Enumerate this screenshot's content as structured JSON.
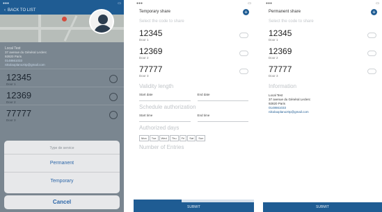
{
  "phone1": {
    "status_carrier": "",
    "nav_back_label": "BACK TO LIST",
    "contact": {
      "name": "Local Test",
      "address": "37 avenue du Général Leclerc",
      "city": "92820 Paris",
      "phone": "0148661033",
      "email": "nikolaoplanoz0p@gmail.com"
    },
    "codes": [
      {
        "number": "12345",
        "door": "Door 1"
      },
      {
        "number": "12369",
        "door": "Door 2"
      },
      {
        "number": "77777",
        "door": "Door 3"
      }
    ],
    "sheet": {
      "title": "Type de service",
      "options": [
        "Permanent",
        "Temporary"
      ],
      "cancel": "Cancel"
    }
  },
  "phone2": {
    "title": "Temporary share",
    "hint": "Select the code to share",
    "codes": [
      {
        "number": "12345",
        "door": "Door 1"
      },
      {
        "number": "12369",
        "door": "Door 2"
      },
      {
        "number": "77777",
        "door": "Door 3"
      }
    ],
    "validity_title": "Validity length",
    "start_date": "Start date",
    "end_date": "End date",
    "schedule_title": "Schedule authorization",
    "start_time": "Start time",
    "end_time": "End time",
    "days_title": "Authorized days",
    "days": [
      "Mon",
      "Tue",
      "Wed",
      "Thu",
      "Fri",
      "Sat",
      "Sun"
    ],
    "entries_title": "Number of Entries",
    "progress": 0.4,
    "submit": "SUBMIT"
  },
  "phone3": {
    "title": "Permanent share",
    "hint": "Select the code to share",
    "codes": [
      {
        "number": "12345",
        "door": "Door 1"
      },
      {
        "number": "12369",
        "door": "Door 2"
      },
      {
        "number": "77777",
        "door": "Door 3"
      }
    ],
    "info_title": "Information",
    "contact": {
      "name": "Local Test",
      "address": "37 avenue du Général Leclerc",
      "city": "92820 Paris",
      "phone": "0148661033",
      "email": "nikolaoplanoz0p@gmail.com"
    },
    "submit": "SUBMIT"
  },
  "colors": {
    "primary": "#1f5c93",
    "action": "#2c66a8"
  },
  "icons": [
    "back-chevron-icon",
    "map-pin-icon",
    "avatar-icon",
    "plus-icon"
  ]
}
